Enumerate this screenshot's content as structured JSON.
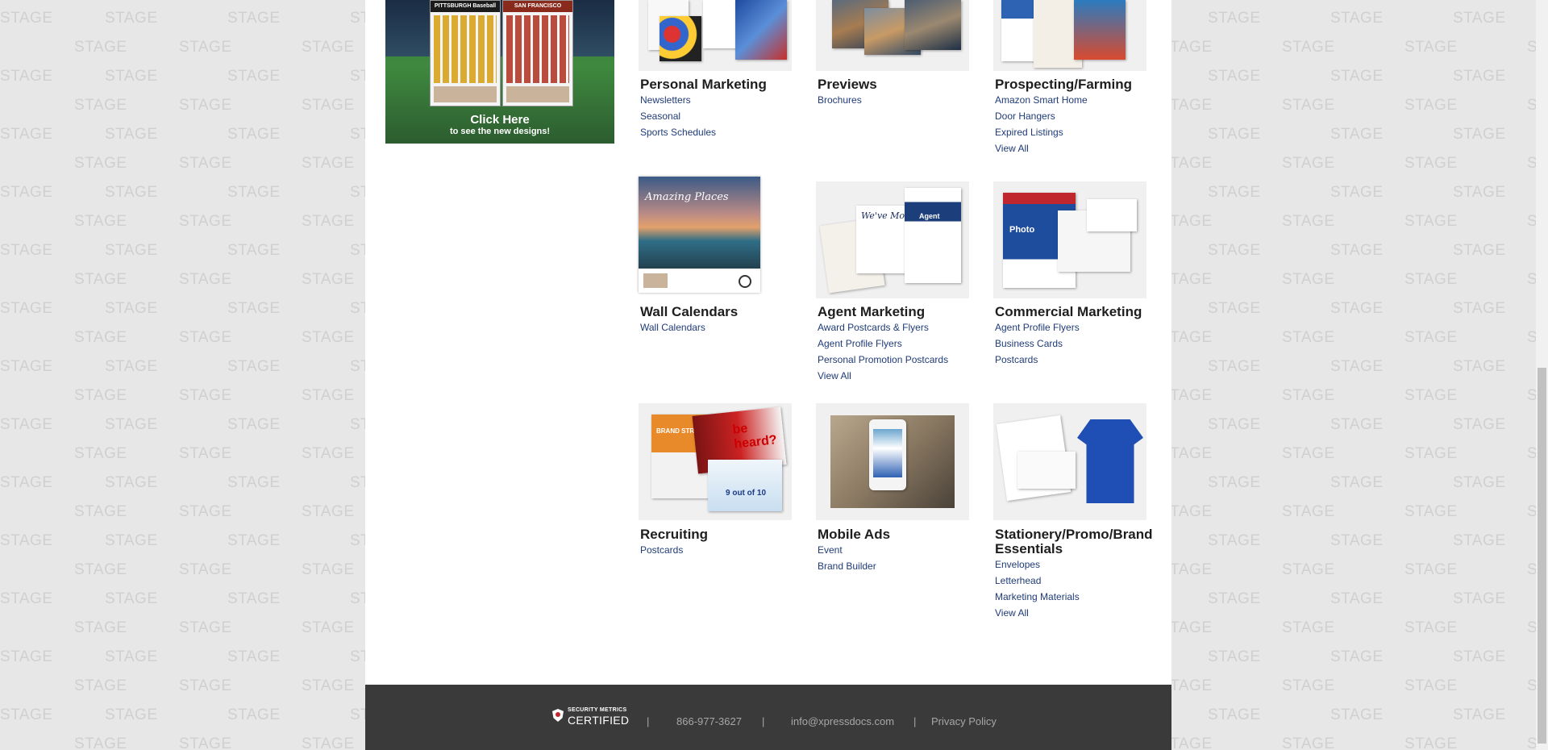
{
  "watermark": "STAGE",
  "promo": {
    "cal1_title": "PITTSBURGH Baseball",
    "cal2_title": "SAN FRANCISCO",
    "cta_main": "Click Here",
    "cta_sub": "to see the new designs!"
  },
  "categories": [
    {
      "title": "Personal Marketing",
      "links": [
        "Newsletters",
        "Seasonal",
        "Sports Schedules"
      ]
    },
    {
      "title": "Previews",
      "links": [
        "Brochures"
      ]
    },
    {
      "title": "Prospecting/Farming",
      "links": [
        "Amazon Smart Home",
        "Door Hangers",
        "Expired Listings",
        "View All"
      ]
    },
    {
      "title": "Wall Calendars",
      "links": [
        "Wall Calendars"
      ]
    },
    {
      "title": "Agent Marketing",
      "links": [
        "Award Postcards & Flyers",
        "Agent Profile Flyers",
        "Personal Promotion Postcards",
        "View All"
      ]
    },
    {
      "title": "Commercial Marketing",
      "links": [
        "Agent Profile Flyers",
        "Business Cards",
        "Postcards"
      ]
    },
    {
      "title": "Recruiting",
      "links": [
        "Postcards"
      ]
    },
    {
      "title": "Mobile Ads",
      "links": [
        "Event",
        "Brand Builder"
      ]
    },
    {
      "title": "Stationery/Promo/Brand Essentials",
      "links": [
        "Envelopes",
        "Letterhead",
        "Marketing Materials",
        "View All"
      ]
    }
  ],
  "thumb_text": {
    "wall": "Amazing Places",
    "agent_1": "We've Moved",
    "agent_2": "Agent Photo",
    "commercial": "Photo",
    "recruit_1": "be heard?",
    "recruit_2": "BRAND STRE",
    "recruit_3": "9 out of 10"
  },
  "footer": {
    "cert_top": "SECURITY METRICS",
    "cert_main": "CERTIFIED",
    "sep": "|",
    "phone": "866-977-3627",
    "email": "info@xpressdocs.com",
    "privacy": "Privacy Policy"
  }
}
